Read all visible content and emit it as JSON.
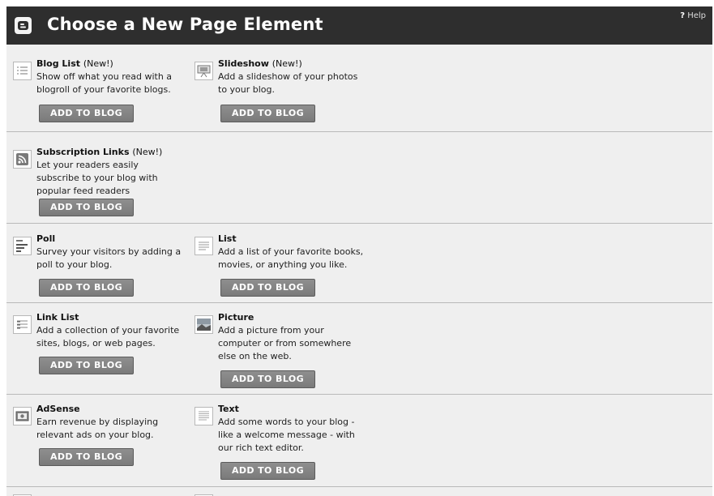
{
  "header": {
    "title": "Choose a New Page Element",
    "help_mark": "?",
    "help_label": "Help"
  },
  "elements": [
    {
      "title": "Blog List",
      "badge": "(New!)",
      "desc": "Show off what you read with a blogroll of your favorite blogs.",
      "icon": "blog-list-icon",
      "button": "ADD TO BLOG"
    },
    {
      "title": "Slideshow",
      "badge": "(New!)",
      "desc": "Add a slideshow of your photos to your blog.",
      "icon": "slideshow-icon",
      "button": "ADD TO BLOG"
    },
    {
      "title": "Subscription Links",
      "badge": "(New!)",
      "desc": "Let your readers easily subscribe to your blog with popular feed readers",
      "icon": "rss-feed-icon",
      "button": "ADD TO BLOG"
    },
    {
      "title": "Poll",
      "badge": "",
      "desc": "Survey your visitors by adding a poll to your blog.",
      "icon": "poll-icon",
      "button": "ADD TO BLOG"
    },
    {
      "title": "List",
      "badge": "",
      "desc": "Add a list of your favorite books, movies, or anything you like.",
      "icon": "list-icon",
      "button": "ADD TO BLOG"
    },
    {
      "title": "Link List",
      "badge": "",
      "desc": "Add a collection of your favorite sites, blogs, or web pages.",
      "icon": "link-list-icon",
      "button": "ADD TO BLOG"
    },
    {
      "title": "Picture",
      "badge": "",
      "desc": "Add a picture from your computer or from somewhere else on the web.",
      "icon": "picture-icon",
      "button": "ADD TO BLOG"
    },
    {
      "title": "AdSense",
      "badge": "",
      "desc": "Earn revenue by displaying relevant ads on your blog.",
      "icon": "adsense-icon",
      "button": "ADD TO BLOG"
    },
    {
      "title": "Text",
      "badge": "",
      "desc": "Add some words to your blog - like a welcome message - with our rich text editor.",
      "icon": "text-icon",
      "button": "ADD TO BLOG"
    }
  ]
}
